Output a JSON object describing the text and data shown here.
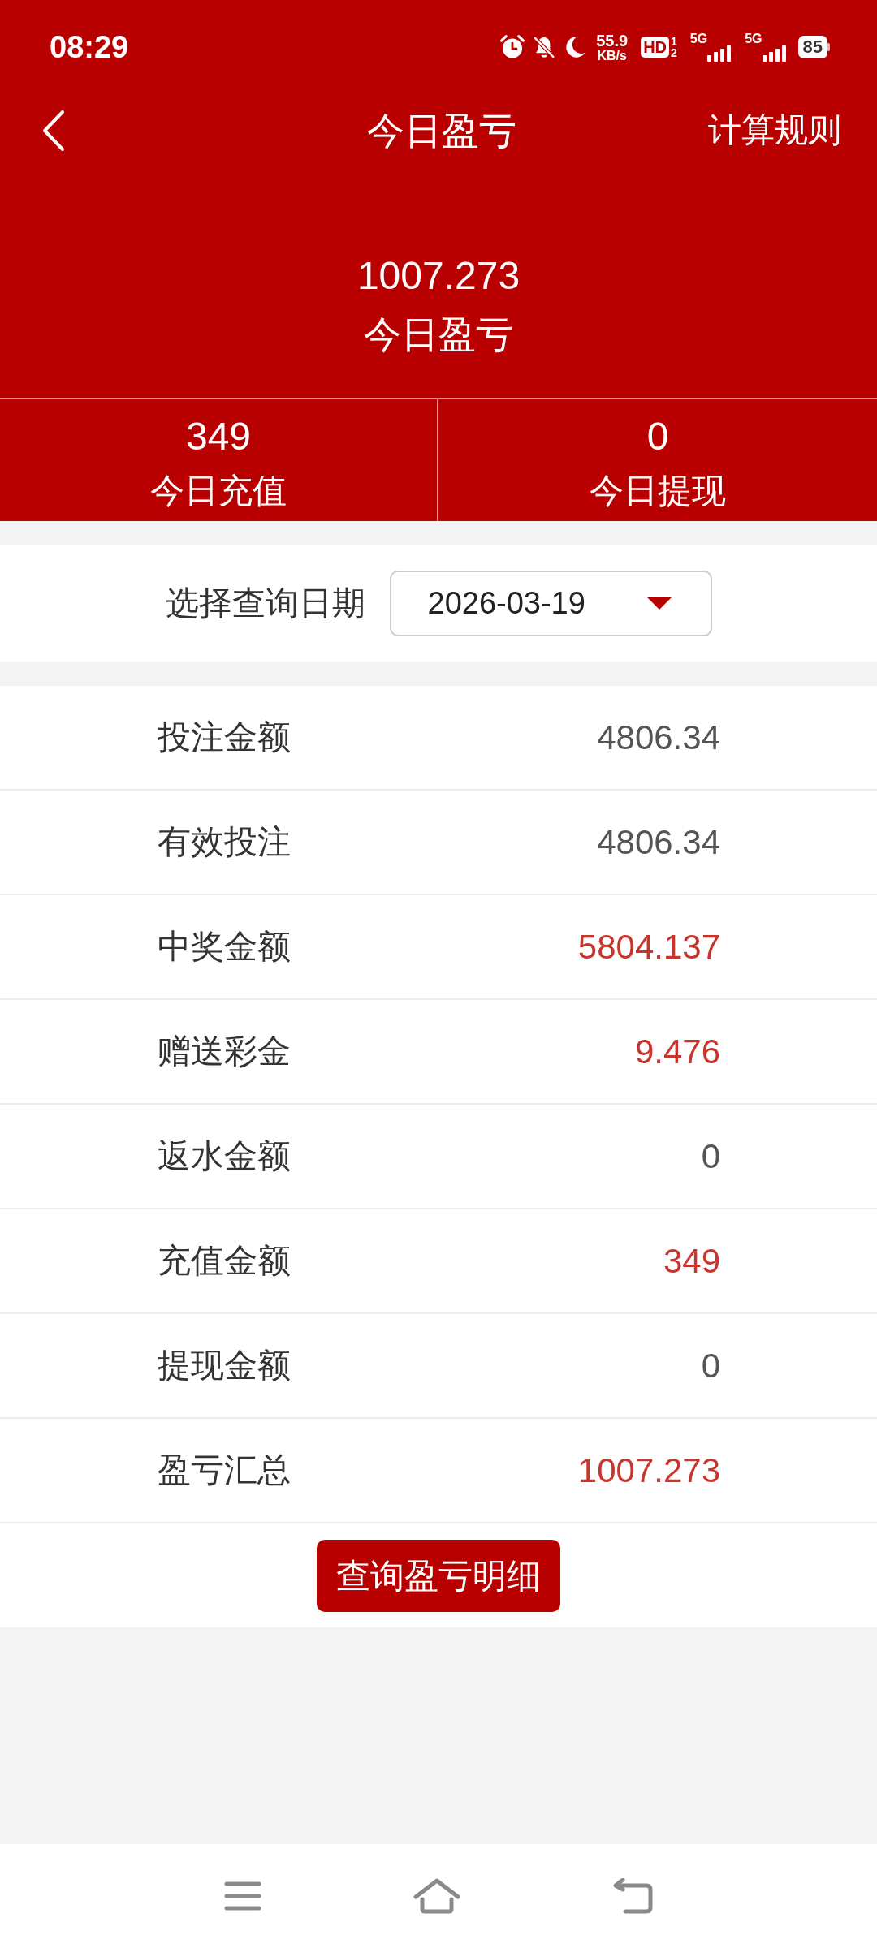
{
  "status_bar": {
    "time": "08:29",
    "net_speed": "55.9",
    "net_speed_unit": "KB/s",
    "hd_badge": "HD",
    "sim_slots": [
      "1",
      "2"
    ],
    "signals": [
      {
        "network": "5G"
      },
      {
        "network": "5G"
      }
    ],
    "battery": "85"
  },
  "header": {
    "title": "今日盈亏",
    "action": "计算规则"
  },
  "summary": {
    "value": "1007.273",
    "label": "今日盈亏"
  },
  "stats": [
    {
      "value": "349",
      "label": "今日充值"
    },
    {
      "value": "0",
      "label": "今日提现"
    }
  ],
  "date_filter": {
    "label": "选择查询日期",
    "value": "2026-03-19"
  },
  "rows": [
    {
      "label": "投注金额",
      "value": "4806.34",
      "color": "#555555"
    },
    {
      "label": "有效投注",
      "value": "4806.34",
      "color": "#555555"
    },
    {
      "label": "中奖金额",
      "value": "5804.137",
      "color": "#c8352c"
    },
    {
      "label": "赠送彩金",
      "value": "9.476",
      "color": "#c8352c"
    },
    {
      "label": "返水金额",
      "value": "0",
      "color": "#555555"
    },
    {
      "label": "充值金额",
      "value": "349",
      "color": "#c8352c"
    },
    {
      "label": "提现金额",
      "value": "0",
      "color": "#555555"
    },
    {
      "label": "盈亏汇总",
      "value": "1007.273",
      "color": "#c8352c"
    }
  ],
  "detail_button": "查询盈亏明细"
}
